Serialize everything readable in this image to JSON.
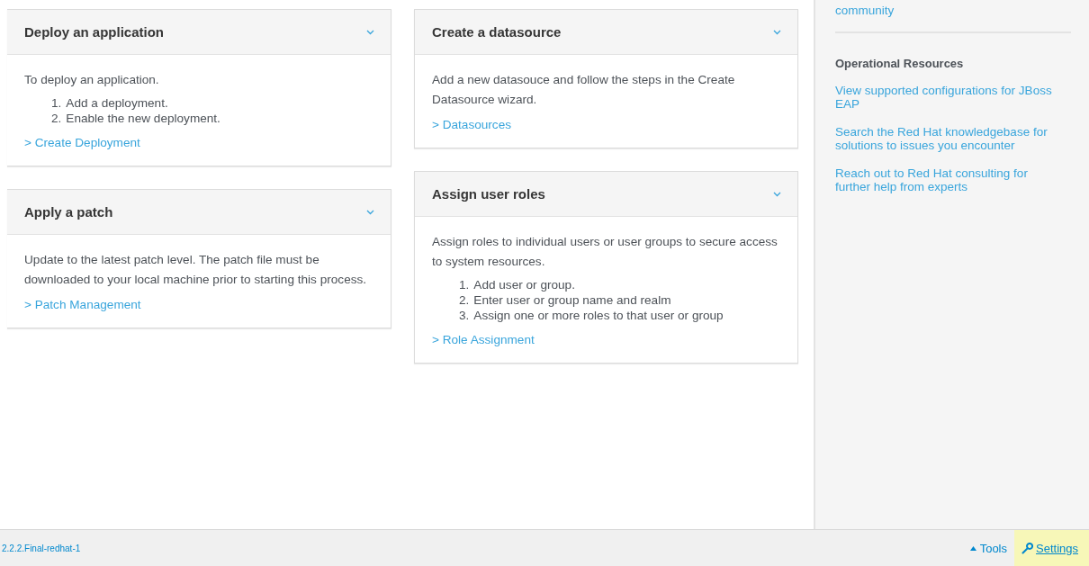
{
  "columns": [
    {
      "cards": [
        {
          "title": "Deploy an application",
          "expanded": true,
          "description": "To deploy an application.",
          "steps": [
            {
              "number": "1.",
              "text": "Add a deployment."
            },
            {
              "number": "2.",
              "text": "Enable the new deployment."
            }
          ],
          "link": "> Create Deployment"
        },
        {
          "title": "Apply a patch",
          "expanded": true,
          "description": "Update to the latest patch level. The patch file must be downloaded to your local machine prior to starting this process.",
          "link": "> Patch Management"
        }
      ]
    },
    {
      "cards": [
        {
          "title": "Create a datasource",
          "expanded": true,
          "description": "Add a new datasouce and follow the steps in the Create Datasource wizard.",
          "link": "> Datasources"
        },
        {
          "title": "Assign user roles",
          "expanded": true,
          "description": "Assign roles to individual users or user groups to secure access to system resources.",
          "steps": [
            {
              "number": "1.",
              "text": "Add user or group."
            },
            {
              "number": "2.",
              "text": "Enter user or group name and realm"
            },
            {
              "number": "3.",
              "text": "Assign one or more roles to that user or group"
            }
          ],
          "link": "> Role Assignment"
        }
      ]
    }
  ],
  "sidebar": {
    "top_link": "community",
    "section_title": "Operational Resources",
    "links": [
      "View supported configurations for JBoss EAP",
      "Search the Red Hat knowledgebase for solutions to issues you encounter",
      "Reach out to Red Hat consulting for further help from experts"
    ]
  },
  "footer": {
    "version": "2.2.2.Final-redhat-1",
    "tools": "Tools",
    "settings": {
      "label": "Settings",
      "selected": true
    }
  }
}
